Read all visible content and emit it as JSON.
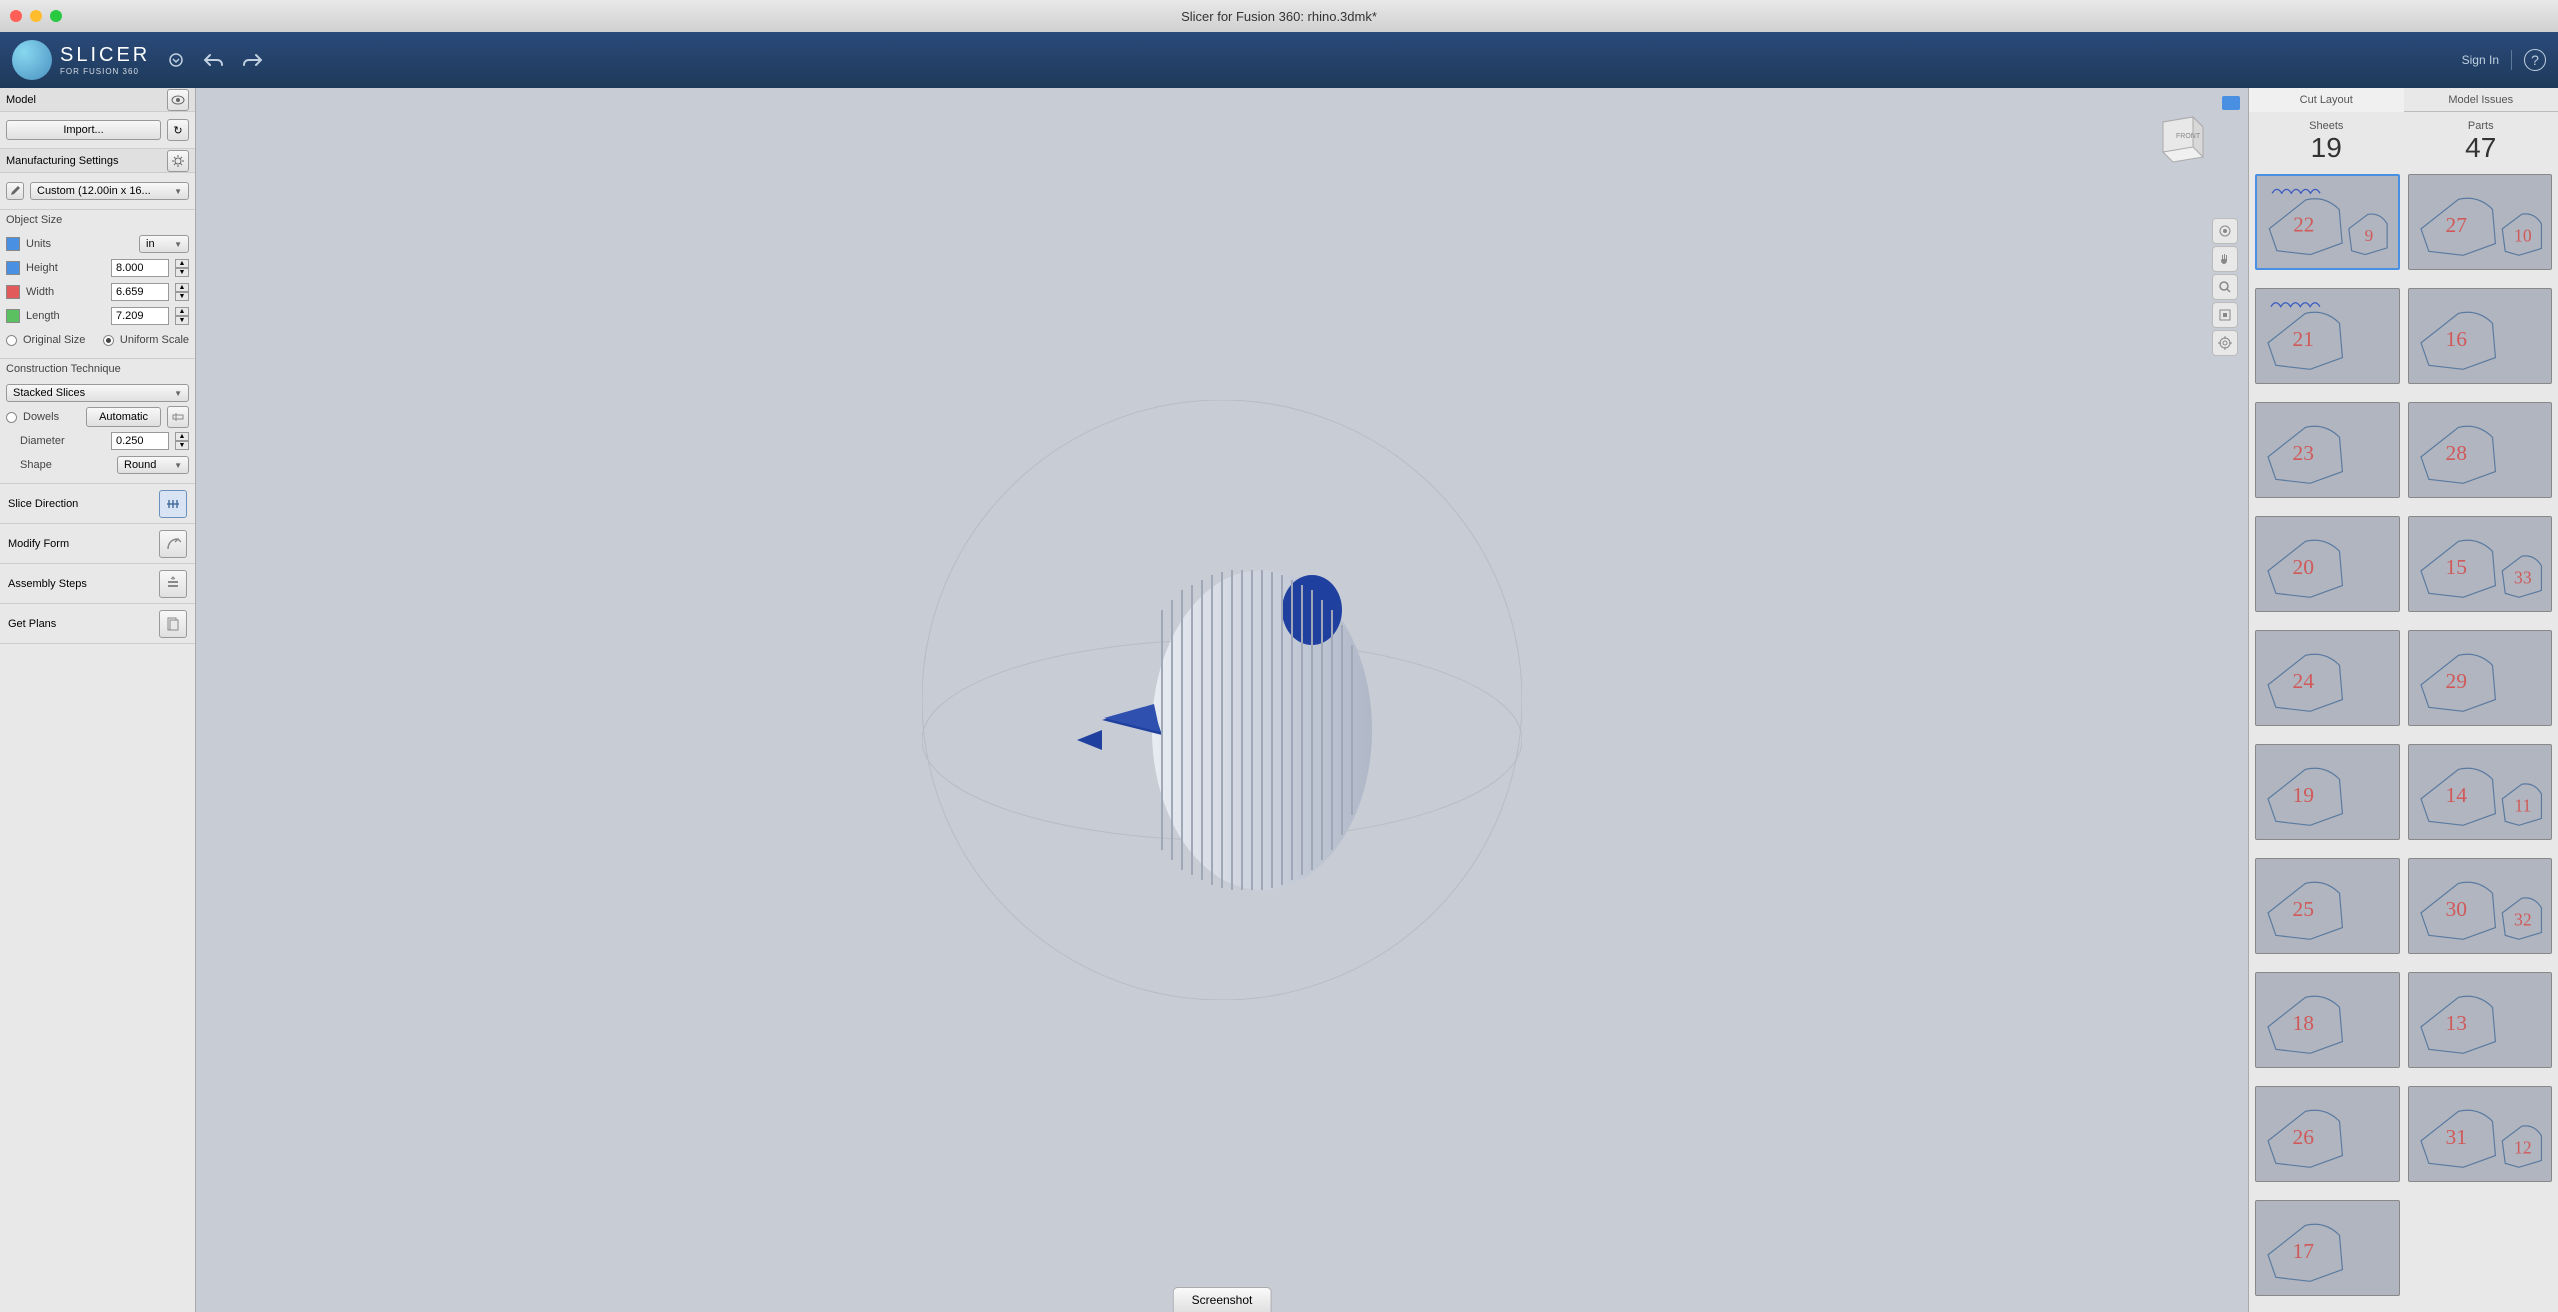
{
  "window": {
    "title": "Slicer for Fusion 360: rhino.3dmk*"
  },
  "header": {
    "logo_main": "SLICER",
    "logo_sub": "FOR FUSION 360",
    "sign_in": "Sign In"
  },
  "left_panel": {
    "model": {
      "header": "Model",
      "import_btn": "Import..."
    },
    "mfg": {
      "header": "Manufacturing Settings",
      "preset": "Custom (12.00in x 16..."
    },
    "object_size": {
      "header": "Object Size",
      "units_label": "Units",
      "units_value": "in",
      "height_label": "Height",
      "height_value": "8.000",
      "width_label": "Width",
      "width_value": "6.659",
      "length_label": "Length",
      "length_value": "7.209",
      "original_size": "Original Size",
      "uniform_scale": "Uniform Scale"
    },
    "construction": {
      "header": "Construction Technique",
      "technique": "Stacked Slices",
      "dowels_label": "Dowels",
      "automatic_btn": "Automatic",
      "diameter_label": "Diameter",
      "diameter_value": "0.250",
      "shape_label": "Shape",
      "shape_value": "Round"
    },
    "slice_direction": "Slice Direction",
    "modify_form": "Modify Form",
    "assembly_steps": "Assembly Steps",
    "get_plans": "Get Plans"
  },
  "viewport": {
    "screenshot_btn": "Screenshot",
    "cube_label": "FRONT"
  },
  "right_panel": {
    "tab_cut_layout": "Cut Layout",
    "tab_model_issues": "Model Issues",
    "sheets_label": "Sheets",
    "sheets_value": "19",
    "parts_label": "Parts",
    "parts_value": "47",
    "thumbs": [
      {
        "nums": [
          "22",
          "9"
        ],
        "sel": true,
        "hasSec": true
      },
      {
        "nums": [
          "27",
          "10"
        ],
        "sel": false,
        "hasSec": true
      },
      {
        "nums": [
          "21"
        ],
        "sel": false,
        "hasSec": false
      },
      {
        "nums": [
          "16"
        ],
        "sel": false,
        "hasSec": false
      },
      {
        "nums": [
          "23"
        ],
        "sel": false,
        "hasSec": false
      },
      {
        "nums": [
          "28"
        ],
        "sel": false,
        "hasSec": false
      },
      {
        "nums": [
          "20"
        ],
        "sel": false,
        "hasSec": false
      },
      {
        "nums": [
          "15",
          "33"
        ],
        "sel": false,
        "hasSec": true
      },
      {
        "nums": [
          "24"
        ],
        "sel": false,
        "hasSec": false
      },
      {
        "nums": [
          "29"
        ],
        "sel": false,
        "hasSec": false
      },
      {
        "nums": [
          "19"
        ],
        "sel": false,
        "hasSec": false
      },
      {
        "nums": [
          "14",
          "11"
        ],
        "sel": false,
        "hasSec": true
      },
      {
        "nums": [
          "25"
        ],
        "sel": false,
        "hasSec": true
      },
      {
        "nums": [
          "30",
          "32"
        ],
        "sel": false,
        "hasSec": true
      },
      {
        "nums": [
          "18"
        ],
        "sel": false,
        "hasSec": false
      },
      {
        "nums": [
          "13"
        ],
        "sel": false,
        "hasSec": false
      },
      {
        "nums": [
          "26"
        ],
        "sel": false,
        "hasSec": false
      },
      {
        "nums": [
          "31",
          "12"
        ],
        "sel": false,
        "hasSec": true
      },
      {
        "nums": [
          "17"
        ],
        "sel": false,
        "hasSec": false
      }
    ]
  }
}
